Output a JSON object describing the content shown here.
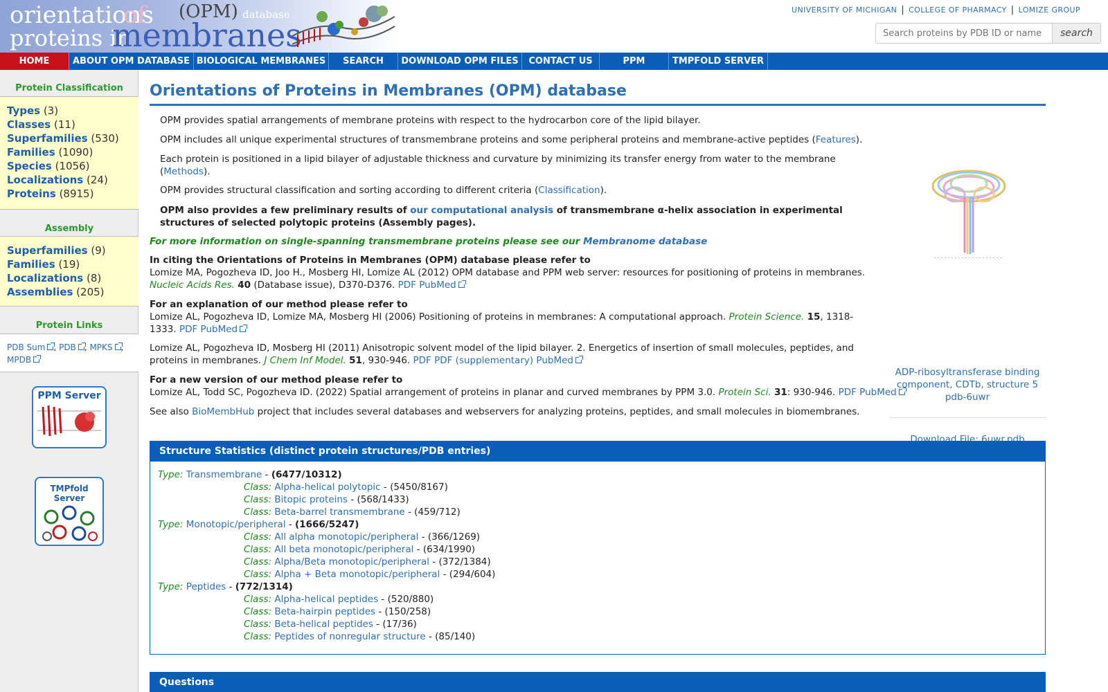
{
  "banner": {
    "line1_a": "orientations",
    "line1_b": "of",
    "line1_c": "(OPM)",
    "line1_d": "database",
    "line2_a": "proteins in",
    "line2_b": "membranes"
  },
  "top_links": [
    "University of Michigan",
    "College of Pharmacy",
    "Lomize Group"
  ],
  "search": {
    "placeholder": "Search proteins by PDB ID or name",
    "button": "search"
  },
  "nav": [
    "HOME",
    "ABOUT OPM DATABASE",
    "BIOLOGICAL MEMBRANES",
    "SEARCH",
    "DOWNLOAD OPM FILES",
    "CONTACT US",
    "PPM",
    "TMPFOLD SERVER"
  ],
  "sidebar": {
    "classification": {
      "title": "Protein Classification",
      "items": [
        {
          "label": "Types",
          "count": "(3)"
        },
        {
          "label": "Classes",
          "count": "(11)"
        },
        {
          "label": "Superfamilies",
          "count": "(530)"
        },
        {
          "label": "Families",
          "count": "(1090)"
        },
        {
          "label": "Species",
          "count": "(1056)"
        },
        {
          "label": "Localizations",
          "count": "(24)"
        },
        {
          "label": "Proteins",
          "count": "(8915)"
        }
      ]
    },
    "assembly": {
      "title": "Assembly",
      "items": [
        {
          "label": "Superfamilies",
          "count": "(9)"
        },
        {
          "label": "Families",
          "count": "(19)"
        },
        {
          "label": "Localizations",
          "count": "(8)"
        },
        {
          "label": "Assemblies",
          "count": "(205)"
        }
      ]
    },
    "links": {
      "title": "Protein Links",
      "items": [
        "PDB Sum",
        "PDB",
        "MPKS",
        "MPDB"
      ]
    },
    "ppm_server": "PPM Server",
    "tmpfold_server": "TMPfold Server"
  },
  "main": {
    "title": "Orientations of Proteins in Membranes (OPM) database",
    "p1": "OPM provides spatial arrangements of membrane proteins with respect to the hydrocarbon core of the lipid bilayer.",
    "p2_text": "OPM includes all unique experimental structures of transmembrane proteins and some peripheral proteins and membrane-active peptides (",
    "p2_link": "Features",
    "p2_end": ").",
    "p3_text": "Each protein is positioned in a lipid bilayer of adjustable thickness and curvature by minimizing its transfer energy from water to the membrane (",
    "p3_link": "Methods",
    "p3_end": ").",
    "p4_text": "OPM provides structural classification and sorting according to different criteria (",
    "p4_link": "Classification",
    "p4_end": ").",
    "p5_a": "OPM also provides a few preliminary results of ",
    "p5_link": "our computational analysis",
    "p5_b": " of transmembrane α-helix association in experimental structures of selected polytopic proteins (Assembly pages).",
    "p6_a": "For more information on single-spanning transmembrane proteins please see our ",
    "p6_link": "Membranome database",
    "cite_head": "In citing the Orientations of Proteins in Membranes (OPM) database please refer to",
    "cite1_a": "Lomize MA, Pogozheva ID, Joo H., Mosberg HI, Lomize AL (2012) OPM database and PPM web server: resources for positioning of proteins in membranes.",
    "cite1_journal": "Nucleic Acids Res.",
    "cite1_vol": "40",
    "cite1_b": "(Database issue), D370-D376.",
    "cite1_links": "PDF PubMed",
    "method_head": "For an explanation of our method please refer to",
    "cite2_a": "Lomize AL, Pogozheva ID, Lomize MA, Mosberg HI (2006) Positioning of proteins in membranes: A computational approach.",
    "cite2_journal": "Protein Science.",
    "cite2_vol": "15",
    "cite2_b": ", 1318-1333.",
    "cite2_links": "PDF PubMed",
    "cite3_a": "Lomize AL, Pogozheva ID, Mosberg HI (2011) Anisotropic solvent model of the lipid bilayer. 2. Energetics of insertion of small molecules, peptides, and proteins in membranes.",
    "cite3_journal": "J Chem Inf Model.",
    "cite3_vol": "51",
    "cite3_b": ", 930-946.",
    "cite3_links": "PDF PDF (supplementary) PubMed",
    "new_head": "For a new version of our method please refer to",
    "cite4_a": "Lomize AL, Todd SC, Pogozheva ID. (2022) Spatial arrangement of proteins in planar and curved membranes by PPM 3.0.",
    "cite4_journal": "Protein Sci.",
    "cite4_vol": "31",
    "cite4_b": ": 930-946.",
    "cite4_links": "PDF PubMed",
    "see_also_a": "See also ",
    "see_also_link": "BioMembHub",
    "see_also_b": " project that includes several databases and webservers for analyzing proteins, peptides, and small molecules in biomembranes."
  },
  "featured": {
    "caption": "ADP-ribosyltransferase binding component, CDTb, structure 5 pdb-6uwr",
    "download": "Download File: 6uwr.pdb"
  },
  "stats": {
    "title": "Structure Statistics (distinct protein structures/PDB entries)",
    "type_label": "Type:",
    "class_label": "Class:",
    "rows": [
      {
        "kind": "type",
        "name": "Transmembrane",
        "count": "(6477/10312)"
      },
      {
        "kind": "class",
        "name": "Alpha-helical polytopic",
        "count": "(5450/8167)"
      },
      {
        "kind": "class",
        "name": "Bitopic proteins",
        "count": "(568/1433)"
      },
      {
        "kind": "class",
        "name": "Beta-barrel transmembrane",
        "count": "(459/712)"
      },
      {
        "kind": "type",
        "name": "Monotopic/peripheral",
        "count": "(1666/5247)"
      },
      {
        "kind": "class",
        "name": "All alpha monotopic/peripheral",
        "count": "(366/1269)"
      },
      {
        "kind": "class",
        "name": "All beta monotopic/peripheral",
        "count": "(634/1990)"
      },
      {
        "kind": "class",
        "name": "Alpha/Beta monotopic/peripheral",
        "count": "(372/1384)"
      },
      {
        "kind": "class",
        "name": "Alpha + Beta monotopic/peripheral",
        "count": "(294/604)"
      },
      {
        "kind": "type",
        "name": "Peptides",
        "count": "(772/1314)"
      },
      {
        "kind": "class",
        "name": "Alpha-helical peptides",
        "count": "(520/880)"
      },
      {
        "kind": "class",
        "name": "Beta-hairpin peptides",
        "count": "(150/258)"
      },
      {
        "kind": "class",
        "name": "Beta-helical peptides",
        "count": "(17/36)"
      },
      {
        "kind": "class",
        "name": "Peptides of nonregular structure",
        "count": "(85/140)"
      }
    ]
  },
  "questions": {
    "title": "Questions"
  },
  "colors": {
    "nav_blue": "#0a5eb8",
    "home_red": "#c8101a",
    "link_blue": "#2f6fb3",
    "sidebar_yellow": "#ffffcc",
    "green": "#1e8a1e"
  }
}
